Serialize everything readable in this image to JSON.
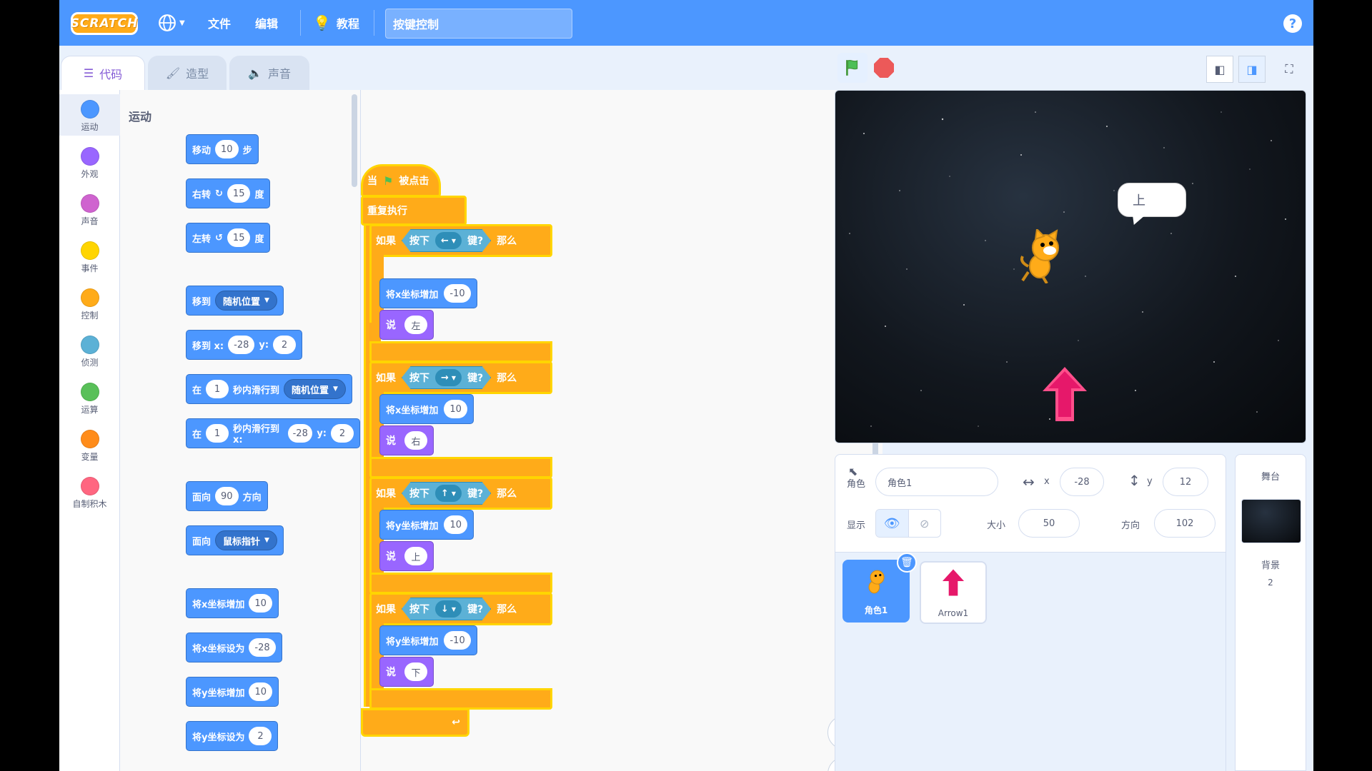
{
  "menubar": {
    "logo": "SCRATCH",
    "file": "文件",
    "edit": "编辑",
    "tutorials": "教程",
    "project_title": "按键控制",
    "help": "?"
  },
  "tabs": {
    "code": "代码",
    "costumes": "造型",
    "sounds": "声音"
  },
  "categories": [
    {
      "label": "运动",
      "color": "#4c97ff"
    },
    {
      "label": "外观",
      "color": "#9966ff"
    },
    {
      "label": "声音",
      "color": "#cf63cf"
    },
    {
      "label": "事件",
      "color": "#ffd500"
    },
    {
      "label": "控制",
      "color": "#ffab19"
    },
    {
      "label": "侦测",
      "color": "#5cb1d6"
    },
    {
      "label": "运算",
      "color": "#59c059"
    },
    {
      "label": "变量",
      "color": "#ff8c1a"
    },
    {
      "label": "自制积木",
      "color": "#ff6680"
    }
  ],
  "palette": {
    "heading": "运动",
    "move": {
      "a": "移动",
      "v": "10",
      "b": "步"
    },
    "turn_right": {
      "a": "右转",
      "v": "15",
      "b": "度"
    },
    "turn_left": {
      "a": "左转",
      "v": "15",
      "b": "度"
    },
    "goto": {
      "a": "移到",
      "d": "随机位置"
    },
    "goto_xy": {
      "a": "移到 x:",
      "x": "-28",
      "b": "y:",
      "y": "2"
    },
    "glide": {
      "a": "在",
      "v": "1",
      "b": "秒内滑行到",
      "d": "随机位置"
    },
    "glide_xy": {
      "a": "在",
      "v": "1",
      "b": "秒内滑行到 x:",
      "x": "-28",
      "c": "y:",
      "y": "2"
    },
    "point_dir": {
      "a": "面向",
      "v": "90",
      "b": "方向"
    },
    "point_towards": {
      "a": "面向",
      "d": "鼠标指针"
    },
    "change_x": {
      "a": "将x坐标增加",
      "v": "10"
    },
    "set_x": {
      "a": "将x坐标设为",
      "v": "-28"
    },
    "change_y": {
      "a": "将y坐标增加",
      "v": "10"
    },
    "set_y": {
      "a": "将y坐标设为",
      "v": "2"
    }
  },
  "script": {
    "hat": {
      "a": "当",
      "b": "被点击"
    },
    "forever": "重复执行",
    "if_label": "如果",
    "then_label": "那么",
    "press": "按下",
    "key_q": "键?",
    "blocks": [
      {
        "key": "←",
        "action": "将x坐标增加",
        "val": "-10",
        "say": "说",
        "text": "左"
      },
      {
        "key": "→",
        "action": "将x坐标增加",
        "val": "10",
        "say": "说",
        "text": "右"
      },
      {
        "key": "↑",
        "action": "将y坐标增加",
        "val": "10",
        "say": "说",
        "text": "上"
      },
      {
        "key": "↓",
        "action": "将y坐标增加",
        "val": "-10",
        "say": "说",
        "text": "下"
      }
    ]
  },
  "stage": {
    "speech": "上"
  },
  "sprite_info": {
    "sprite_label": "角色",
    "name": "角色1",
    "x_label": "x",
    "x": "-28",
    "y_label": "y",
    "y": "12",
    "show_label": "显示",
    "size_label": "大小",
    "size": "50",
    "direction_label": "方向",
    "direction": "102"
  },
  "sprites": [
    {
      "name": "角色1"
    },
    {
      "name": "Arrow1"
    }
  ],
  "stage_pane": {
    "title": "舞台",
    "backdrop_label": "背景",
    "backdrop_count": "2"
  }
}
